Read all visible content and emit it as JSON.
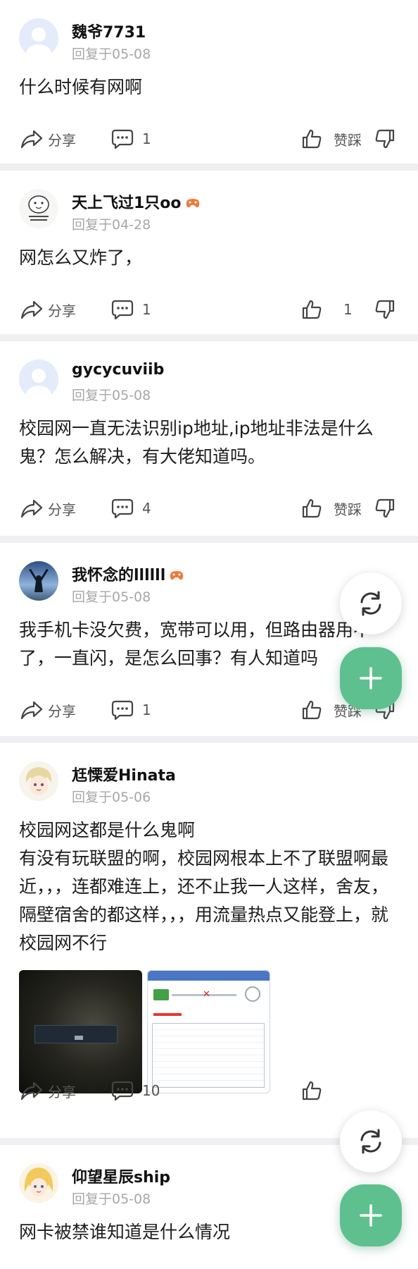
{
  "colors": {
    "accent": "#5fc08f",
    "text_muted": "#a7a7a7",
    "separator": "#f0f0f2"
  },
  "actions": {
    "share_label": "分享",
    "like_label": "赞踩"
  },
  "posts": [
    {
      "user": "魏爷7731",
      "avatar_icon": "default-avatar-icon",
      "reply_date": "回复于05-08",
      "paragraphs": [
        "什么时候有网啊"
      ],
      "comments": "1",
      "likes": "",
      "badge": false
    },
    {
      "user": "天上飞过1只oo",
      "avatar_icon": "sticker-avatar-icon",
      "reply_date": "回复于04-28",
      "paragraphs": [
        "网怎么又炸了，"
      ],
      "comments": "1",
      "likes": "1",
      "badge": true
    },
    {
      "user": "gycycuviib",
      "avatar_icon": "default-avatar-icon",
      "reply_date": "回复于05-08",
      "paragraphs": [
        "校园网一直无法识别ip地址,ip地址非法是什么鬼？怎么解决，有大佬知道吗。"
      ],
      "comments": "4",
      "likes": "",
      "badge": false
    },
    {
      "user": "我怀念的llllll",
      "avatar_icon": "silhouette-avatar-icon",
      "reply_date": "回复于05-08",
      "paragraphs": [
        "我手机卡没欠费，宽带可以用，但路由器用不了，一直闪，是怎么回事？有人知道吗"
      ],
      "comments": "1",
      "likes": "",
      "badge": true
    },
    {
      "user": "尪慄爱Hinata",
      "avatar_icon": "anime-avatar-icon",
      "reply_date": "回复于05-06",
      "paragraphs": [
        "校园网这都是什么鬼啊",
        "有没有玩联盟的啊，校园网根本上不了联盟啊最近，，，连都难连上，还不止我一人这样，舍友，隔壁宿舍的都这样，，，用流量热点又能登上，就校园网不行"
      ],
      "comments": "10",
      "likes": "",
      "badge": false,
      "has_images": true
    },
    {
      "user": "仰望星辰ship",
      "avatar_icon": "anime-avatar-icon",
      "reply_date": "回复于05-08",
      "paragraphs": [
        "网卡被禁谁知道是什么情况"
      ],
      "comments": "",
      "likes": "",
      "badge": false
    }
  ]
}
